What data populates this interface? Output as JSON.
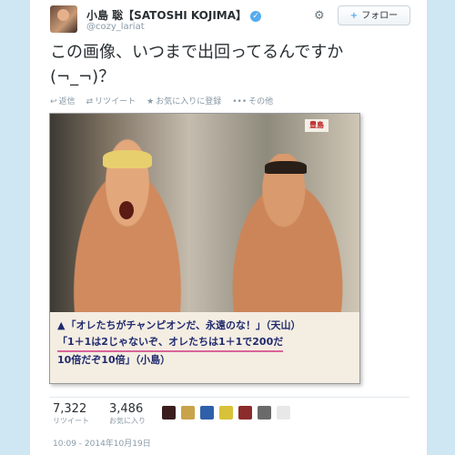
{
  "user": {
    "display_name": "小島 聡【SATOSHI KOJIMA】",
    "handle": "@cozy_lariat",
    "verified_glyph": "✓"
  },
  "header": {
    "settings_icon": "gear-icon",
    "follow_label": "フォロー",
    "follow_plus": "+"
  },
  "tweet": {
    "text_line1": "この画像、いつまで出回ってるんですか",
    "text_line2": "(¬_¬)？"
  },
  "actions": {
    "reply": "返信",
    "retweet": "リツイート",
    "favorite": "お気に入りに登録",
    "more": "その他"
  },
  "photo": {
    "sign_text": "豊島",
    "caption_line1": "「オレたちがチャンピオンだ、永遠のな！」（天山）",
    "caption_line2": "「1＋1は2じゃないぞ、オレたちは1＋1で200だ",
    "caption_line3": "10倍だぞ10倍」（小島）"
  },
  "stats": {
    "retweets_count": "7,322",
    "retweets_label": "リツイート",
    "favorites_count": "3,486",
    "favorites_label": "お気に入り"
  },
  "favoriters": [
    {
      "color": "#3a1e1e"
    },
    {
      "color": "#c9a34a"
    },
    {
      "color": "#2f5fa8"
    },
    {
      "color": "#d8c23a"
    },
    {
      "color": "#8c2b2b"
    },
    {
      "color": "#6a6a6a"
    },
    {
      "color": "#e8e8e8"
    }
  ],
  "timestamp": "10:09 - 2014年10月19日"
}
